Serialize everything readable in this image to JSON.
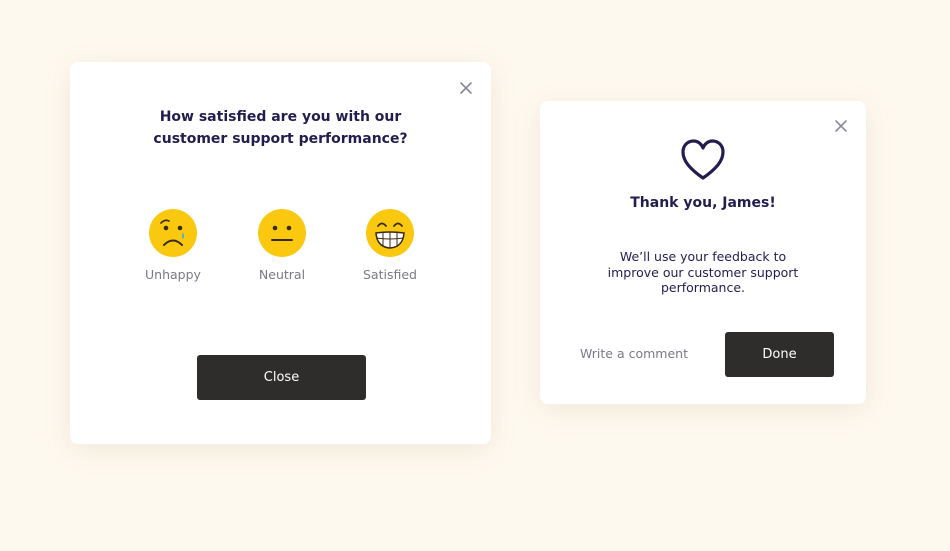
{
  "colors": {
    "background": "#fef9ef",
    "card": "#ffffff",
    "heading_text": "#231d4f",
    "muted_text": "#7a7a86",
    "button_bg": "#2f2d2c",
    "button_text": "#ffffff",
    "emoji_yellow": "#f9c80f"
  },
  "survey_card": {
    "close_icon": "close-icon",
    "question_line1": "How satisfied are you with our",
    "question_line2": "customer support performance?",
    "options": [
      {
        "icon": "sad-face-icon",
        "label": "Unhappy"
      },
      {
        "icon": "neutral-face-icon",
        "label": "Neutral"
      },
      {
        "icon": "grinning-face-icon",
        "label": "Satisfied"
      }
    ],
    "close_button_label": "Close"
  },
  "thanks_card": {
    "close_icon": "close-icon",
    "icon": "heart-icon",
    "title": "Thank you, James!",
    "message": "We’ll use your feedback to improve our customer support performance.",
    "comment_link": "Write a comment",
    "done_button_label": "Done"
  }
}
